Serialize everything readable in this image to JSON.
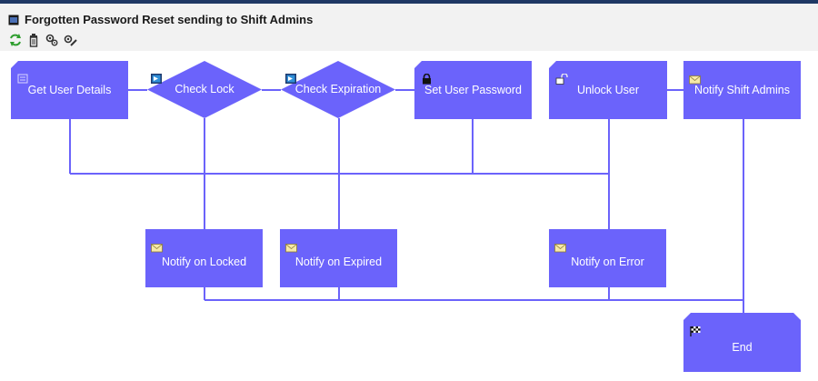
{
  "window": {
    "title": "Forgotten Password Reset sending to Shift Admins"
  },
  "toolbar": {
    "buttons": [
      {
        "name": "refresh-icon"
      },
      {
        "name": "trash-icon"
      },
      {
        "name": "settings-icon"
      },
      {
        "name": "edit-settings-icon"
      }
    ]
  },
  "colors": {
    "node_fill": "#6b63fb",
    "connector": "#6b63fb",
    "label_text": "#ffffff"
  },
  "workflow": {
    "nodes": {
      "get_user_details": {
        "label": "Get User Details",
        "icon": "form-icon"
      },
      "check_lock": {
        "label": "Check Lock",
        "icon": "script-icon"
      },
      "check_expiration": {
        "label": "Check Expiration",
        "icon": "script-icon"
      },
      "set_user_password": {
        "label": "Set User Password",
        "icon": "lock-icon"
      },
      "unlock_user": {
        "label": "Unlock User",
        "icon": "unlock-icon"
      },
      "notify_shift_admins": {
        "label": "Notify Shift Admins",
        "icon": "mail-icon"
      },
      "notify_on_locked": {
        "label": "Notify on Locked",
        "icon": "mail-icon"
      },
      "notify_on_expired": {
        "label": "Notify on Expired",
        "icon": "mail-icon"
      },
      "notify_on_error": {
        "label": "Notify on Error",
        "icon": "mail-icon"
      },
      "end": {
        "label": "End",
        "icon": "checkered-flag-icon"
      }
    }
  }
}
